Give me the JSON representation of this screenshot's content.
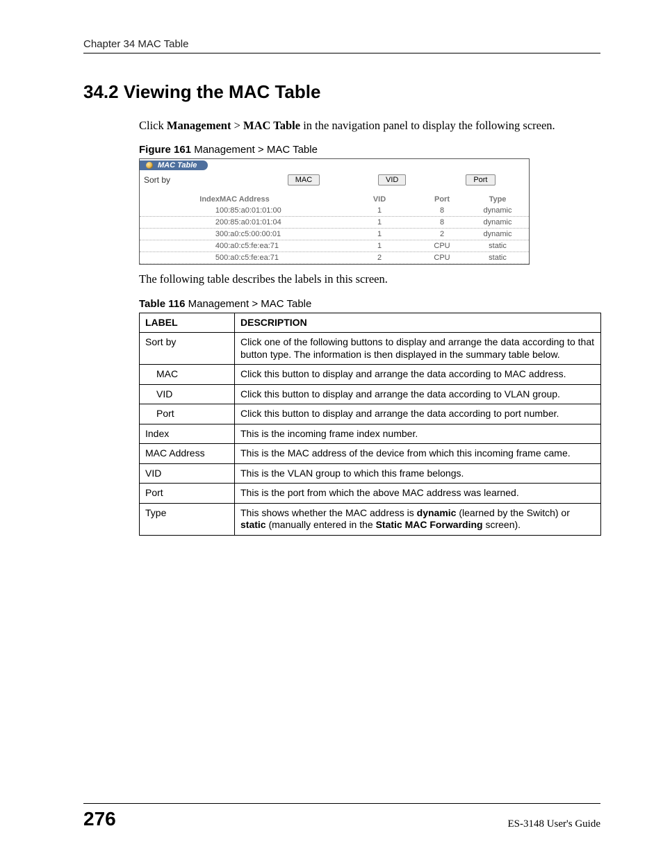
{
  "chapter_header": "Chapter 34 MAC Table",
  "section_heading": "34.2  Viewing the MAC Table",
  "intro": {
    "pre": "Click ",
    "b1": "Management",
    "gt": " > ",
    "b2": "MAC Table",
    "post": " in the navigation panel to display the following screen."
  },
  "figure_caption": {
    "bold": "Figure 161",
    "rest": "   Management > MAC Table"
  },
  "figure": {
    "tab_title": "MAC Table",
    "sortby_label": "Sort by",
    "buttons": {
      "mac": "MAC",
      "vid": "VID",
      "port": "Port"
    },
    "headers": {
      "index": "Index",
      "mac": "MAC Address",
      "vid": "VID",
      "port": "Port",
      "type": "Type"
    },
    "rows": [
      {
        "index": "1",
        "mac": "00:85:a0:01:01:00",
        "vid": "1",
        "port": "8",
        "type": "dynamic"
      },
      {
        "index": "2",
        "mac": "00:85:a0:01:01:04",
        "vid": "1",
        "port": "8",
        "type": "dynamic"
      },
      {
        "index": "3",
        "mac": "00:a0:c5:00:00:01",
        "vid": "1",
        "port": "2",
        "type": "dynamic"
      },
      {
        "index": "4",
        "mac": "00:a0:c5:fe:ea:71",
        "vid": "1",
        "port": "CPU",
        "type": "static"
      },
      {
        "index": "5",
        "mac": "00:a0:c5:fe:ea:71",
        "vid": "2",
        "port": "CPU",
        "type": "static"
      }
    ]
  },
  "table_intro": "The following table describes the labels in this screen.",
  "table_caption": {
    "bold": "Table 116",
    "rest": "   Management > MAC Table"
  },
  "desc_table": {
    "headers": {
      "label": "LABEL",
      "desc": "DESCRIPTION"
    },
    "rows": [
      {
        "label": "Sort by",
        "indent": false,
        "desc": "Click one of the following buttons to display and arrange the data according to that button type. The information is then displayed in the summary table below."
      },
      {
        "label": "MAC",
        "indent": true,
        "desc": "Click this button to display and arrange the data according to MAC address."
      },
      {
        "label": "VID",
        "indent": true,
        "desc": "Click this button to display and arrange the data according to VLAN group."
      },
      {
        "label": "Port",
        "indent": true,
        "desc": "Click this button to display and arrange the data according to port number."
      },
      {
        "label": "Index",
        "indent": false,
        "desc": "This is the incoming frame index number."
      },
      {
        "label": "MAC Address",
        "indent": false,
        "desc": "This is the MAC address of the device from which this incoming frame came."
      },
      {
        "label": "VID",
        "indent": false,
        "desc": "This is the VLAN group to which this frame belongs."
      },
      {
        "label": "Port",
        "indent": false,
        "desc": "This is the port from which the above MAC address was learned."
      }
    ],
    "type_row": {
      "label": "Type",
      "parts": {
        "p1": "This shows whether the MAC address is ",
        "b1": "dynamic",
        "p2": " (learned by the Switch) or ",
        "b2": "static",
        "p3": " (manually entered in the ",
        "b3": "Static MAC Forwarding",
        "p4": " screen)."
      }
    }
  },
  "footer": {
    "page": "276",
    "guide": "ES-3148 User's Guide"
  }
}
